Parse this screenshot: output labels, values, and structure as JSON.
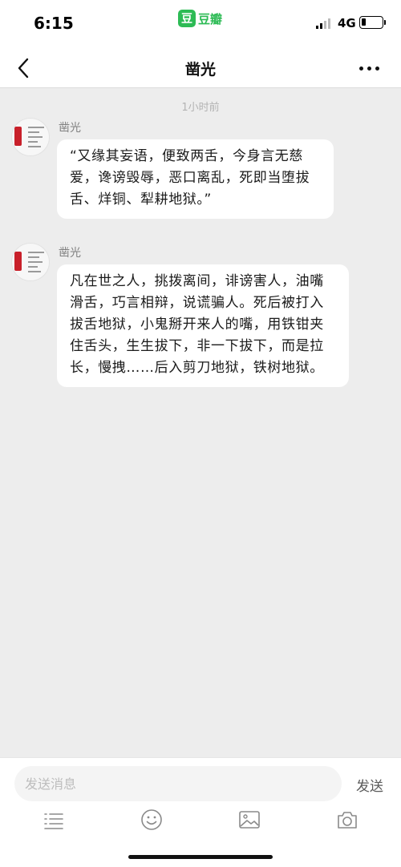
{
  "status_bar": {
    "time": "6:15",
    "app_name": "豆瓣",
    "app_badge_glyph": "豆",
    "network": "4G",
    "battery_level": 0.2,
    "icons": [
      "signal-icon",
      "battery-icon"
    ]
  },
  "nav": {
    "title": "凿光",
    "back_icon": "chevron-left-icon",
    "more_icon": "more-dots-icon"
  },
  "chat": {
    "timestamp": "1小时前",
    "messages": [
      {
        "sender": "凿光",
        "lines": [
          "“又缘其妄语，便致两舌，今身言无慈",
          "爱，谗谤毁辱，恶口离乱，死即当堕拔",
          "舌、烊铜、犁耕地狱。”"
        ]
      },
      {
        "sender": "凿光",
        "lines": [
          "凡在世之人，挑拨离间，诽谤害人，油嘴",
          "滑舌，巧言相辩，说谎骗人。死后被打入",
          "拔舌地狱，小鬼掰开来人的嘴，用铁钳夹",
          "住舌头，生生拔下，非一下拔下，而是拉",
          "长，慢拽……后入剪刀地狱，铁树地狱。"
        ]
      }
    ]
  },
  "input": {
    "placeholder": "发送消息",
    "value": "",
    "send_label": "发送",
    "toolbar_icons": [
      "menu-lines-icon",
      "emoji-icon",
      "image-icon",
      "camera-icon"
    ]
  },
  "colors": {
    "background": "#ededed",
    "bubble": "#ffffff",
    "brand_green": "#2dbb55"
  }
}
